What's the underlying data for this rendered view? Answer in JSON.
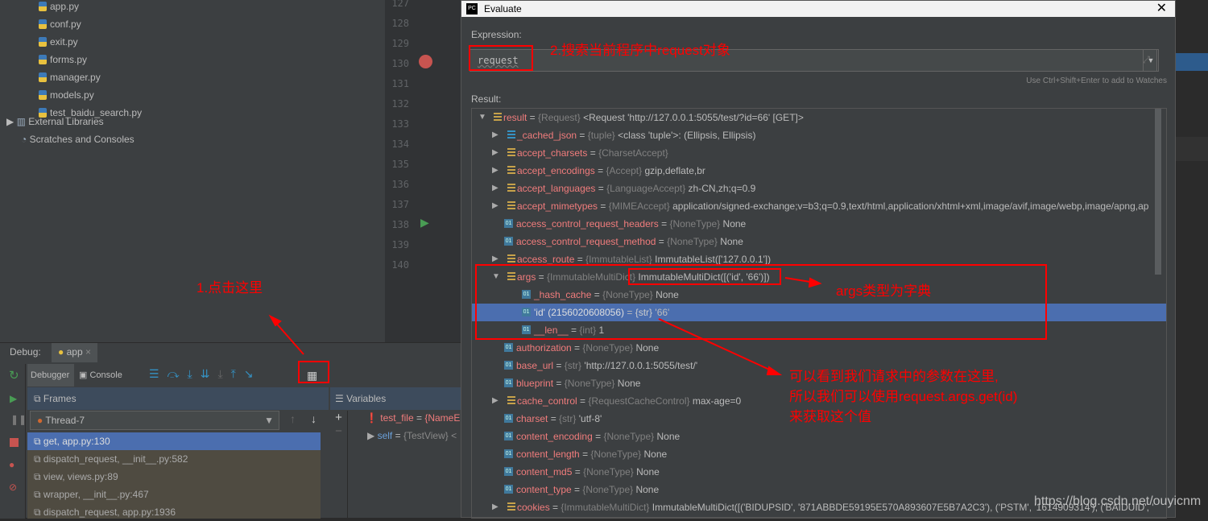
{
  "project": {
    "files": [
      "app.py",
      "conf.py",
      "exit.py",
      "forms.py",
      "manager.py",
      "models.py",
      "test_baidu_search.py"
    ],
    "external": "External Libraries",
    "scratches": "Scratches and Consoles"
  },
  "editor": {
    "lines": [
      "127",
      "128",
      "129",
      "130",
      "131",
      "132",
      "133",
      "134",
      "135",
      "136",
      "137",
      "138",
      "139",
      "140"
    ]
  },
  "debug": {
    "label": "Debug:",
    "tab": "app",
    "debugger_tab": "Debugger",
    "console_tab": "Console",
    "frames_label": "Frames",
    "variables_label": "Variables",
    "thread": "Thread-7",
    "frames": [
      "get, app.py:130",
      "dispatch_request, __init__.py:582",
      "view, views.py:89",
      "wrapper, __init__.py:467",
      "dispatch_request, app.py:1936"
    ],
    "variables": [
      {
        "name": "test_file",
        "value": "{NameE"
      },
      {
        "name": "self",
        "value": "{TestView} <"
      }
    ]
  },
  "dialog": {
    "title": "Evaluate",
    "expression_label": "Expression:",
    "expression": "request",
    "hint": "Use Ctrl+Shift+Enter to add to Watches",
    "result_label": "Result:",
    "rows": [
      {
        "lvl": 0,
        "exp": "open",
        "icon": "field",
        "name": "result",
        "type": "{Request}",
        "value": "<Request 'http://127.0.0.1:5055/test/?id=66' [GET]>"
      },
      {
        "lvl": 1,
        "exp": "closed",
        "icon": "list",
        "name": "_cached_json",
        "type": "{tuple}",
        "value": "<class 'tuple'>: (Ellipsis, Ellipsis)"
      },
      {
        "lvl": 1,
        "exp": "closed",
        "icon": "field",
        "name": "accept_charsets",
        "type": "{CharsetAccept}",
        "value": ""
      },
      {
        "lvl": 1,
        "exp": "closed",
        "icon": "field",
        "name": "accept_encodings",
        "type": "{Accept}",
        "value": "gzip,deflate,br"
      },
      {
        "lvl": 1,
        "exp": "closed",
        "icon": "field",
        "name": "accept_languages",
        "type": "{LanguageAccept}",
        "value": "zh-CN,zh;q=0.9"
      },
      {
        "lvl": 1,
        "exp": "closed",
        "icon": "field",
        "name": "accept_mimetypes",
        "type": "{MIMEAccept}",
        "value": "application/signed-exchange;v=b3;q=0.9,text/html,application/xhtml+xml,image/avif,image/webp,image/apng,ap"
      },
      {
        "lvl": 1,
        "exp": "",
        "icon": "01",
        "name": "access_control_request_headers",
        "type": "{NoneType}",
        "value": "None"
      },
      {
        "lvl": 1,
        "exp": "",
        "icon": "01",
        "name": "access_control_request_method",
        "type": "{NoneType}",
        "value": "None"
      },
      {
        "lvl": 1,
        "exp": "closed",
        "icon": "field",
        "name": "access_route",
        "type": "{ImmutableList}",
        "value": "ImmutableList(['127.0.0.1'])"
      },
      {
        "lvl": 1,
        "exp": "open",
        "icon": "field",
        "name": "args",
        "type": "{ImmutableMultiDict}",
        "value": "ImmutableMultiDict([('id', '66')])"
      },
      {
        "lvl": 2,
        "exp": "",
        "icon": "01",
        "name": "_hash_cache",
        "type": "{NoneType}",
        "value": "None"
      },
      {
        "lvl": 2,
        "exp": "",
        "icon": "01",
        "name": "'id' (2156020608056)",
        "type": "{str}",
        "value": "'66'",
        "selected": true
      },
      {
        "lvl": 2,
        "exp": "",
        "icon": "01",
        "name": "__len__",
        "type": "{int}",
        "value": "1"
      },
      {
        "lvl": 1,
        "exp": "",
        "icon": "01",
        "name": "authorization",
        "type": "{NoneType}",
        "value": "None"
      },
      {
        "lvl": 1,
        "exp": "",
        "icon": "01",
        "name": "base_url",
        "type": "{str}",
        "value": "'http://127.0.0.1:5055/test/'"
      },
      {
        "lvl": 1,
        "exp": "",
        "icon": "01",
        "name": "blueprint",
        "type": "{NoneType}",
        "value": "None"
      },
      {
        "lvl": 1,
        "exp": "closed",
        "icon": "field",
        "name": "cache_control",
        "type": "{RequestCacheControl}",
        "value": "max-age=0"
      },
      {
        "lvl": 1,
        "exp": "",
        "icon": "01",
        "name": "charset",
        "type": "{str}",
        "value": "'utf-8'"
      },
      {
        "lvl": 1,
        "exp": "",
        "icon": "01",
        "name": "content_encoding",
        "type": "{NoneType}",
        "value": "None"
      },
      {
        "lvl": 1,
        "exp": "",
        "icon": "01",
        "name": "content_length",
        "type": "{NoneType}",
        "value": "None"
      },
      {
        "lvl": 1,
        "exp": "",
        "icon": "01",
        "name": "content_md5",
        "type": "{NoneType}",
        "value": "None"
      },
      {
        "lvl": 1,
        "exp": "",
        "icon": "01",
        "name": "content_type",
        "type": "{NoneType}",
        "value": "None"
      },
      {
        "lvl": 1,
        "exp": "closed",
        "icon": "field",
        "name": "cookies",
        "type": "{ImmutableMultiDict}",
        "value": "ImmutableMultiDict([('BIDUPSID', '871ABBDE59195E570A893607E5B7A2C3'), ('PSTM', '1614909314'), ('BAIDUID', '"
      }
    ]
  },
  "annotations": {
    "step1": "1.点击这里",
    "step2": "2.搜索当前程序中request对象",
    "args_note": "args类型为字典",
    "explain": [
      "可以看到我们请求中的参数在这里,",
      "所以我们可以使用request.args.get(id)",
      "来获取这个值"
    ],
    "watermark": "https://blog.csdn.net/ouyicnm"
  }
}
